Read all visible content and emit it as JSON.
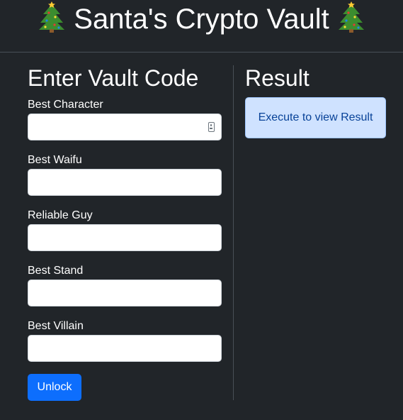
{
  "header": {
    "title": "Santa's Crypto Vault"
  },
  "form": {
    "heading": "Enter Vault Code",
    "fields": [
      {
        "label": "Best Character",
        "value": ""
      },
      {
        "label": "Best Waifu",
        "value": ""
      },
      {
        "label": "Reliable Guy",
        "value": ""
      },
      {
        "label": "Best Stand",
        "value": ""
      },
      {
        "label": "Best Villain",
        "value": ""
      }
    ],
    "submit_label": "Unlock"
  },
  "result": {
    "heading": "Result",
    "message": "Execute to view Result"
  },
  "icons": {
    "decoration": "christmas-tree-icon",
    "autofill": "contact-card-icon"
  },
  "colors": {
    "background": "#212529",
    "primary_button": "#0d6efd",
    "result_box_bg": "#cfe2ff",
    "result_box_text": "#084298"
  }
}
